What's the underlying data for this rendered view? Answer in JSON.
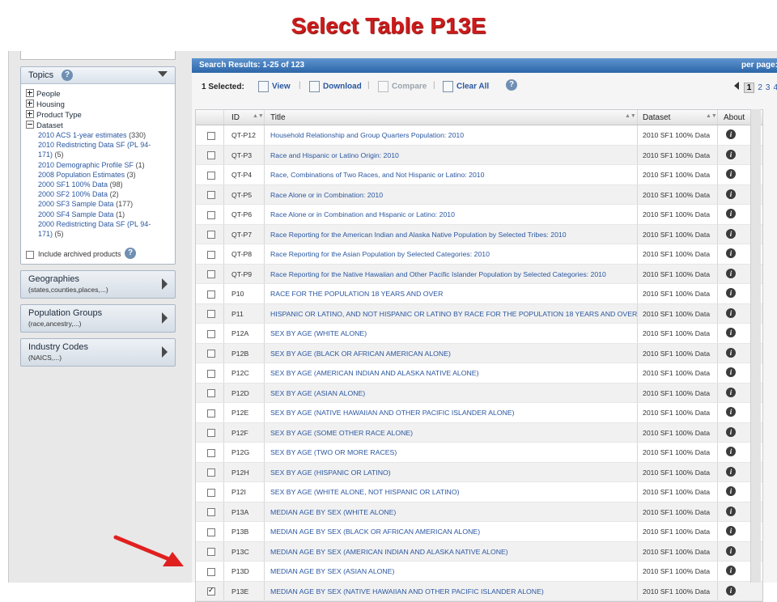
{
  "slide": {
    "title": "Select Table P13E"
  },
  "sidebar": {
    "topics": {
      "label": "Topics",
      "items": [
        {
          "label": "People",
          "state": "collapsed"
        },
        {
          "label": "Housing",
          "state": "collapsed"
        },
        {
          "label": "Product Type",
          "state": "collapsed"
        },
        {
          "label": "Dataset",
          "state": "expanded"
        }
      ],
      "datasets": [
        {
          "name": "2010 ACS 1-year estimates",
          "count": "(330)"
        },
        {
          "name": "2010 Redistricting Data SF (PL 94-",
          "name2": "171)",
          "count": "(5)"
        },
        {
          "name": "2010 Demographic Profile SF",
          "count": "(1)"
        },
        {
          "name": "2008 Population Estimates",
          "count": "(3)"
        },
        {
          "name": "2000 SF1 100% Data",
          "count": "(98)"
        },
        {
          "name": "2000 SF2 100% Data",
          "count": "(2)"
        },
        {
          "name": "2000 SF3 Sample Data",
          "count": "(177)"
        },
        {
          "name": "2000 SF4 Sample Data",
          "count": "(1)"
        },
        {
          "name": "2000 Redistricting Data SF (PL 94-",
          "name2": "171)",
          "count": "(5)"
        }
      ],
      "archived_label": "Include archived products"
    },
    "geographies": {
      "title": "Geographies",
      "subtitle": "(states,counties,places,...)"
    },
    "population_groups": {
      "title": "Population Groups",
      "subtitle": "(race,ancestry,...)"
    },
    "industry_codes": {
      "title": "Industry Codes",
      "subtitle": "(NAICS,...)"
    }
  },
  "results": {
    "header": {
      "prefix": "Search Results:",
      "range": "1-25",
      "of": "of",
      "total": "123",
      "per_page": "per page:"
    },
    "toolbar": {
      "selected_count": "1",
      "selected_label": "Selected:",
      "view": "View",
      "download": "Download",
      "compare": "Compare",
      "clear_all": "Clear All"
    },
    "pager": {
      "pages": [
        "1",
        "2",
        "3",
        "4"
      ],
      "current": "1"
    },
    "columns": {
      "id": "ID",
      "title": "Title",
      "dataset": "Dataset",
      "about": "About"
    },
    "rows": [
      {
        "id": "QT-P12",
        "title": "Household Relationship and Group Quarters Population: 2010",
        "dataset": "2010 SF1 100% Data",
        "checked": false
      },
      {
        "id": "QT-P3",
        "title": "Race and Hispanic or Latino Origin: 2010",
        "dataset": "2010 SF1 100% Data",
        "checked": false
      },
      {
        "id": "QT-P4",
        "title": "Race, Combinations of Two Races, and Not Hispanic or Latino: 2010",
        "dataset": "2010 SF1 100% Data",
        "checked": false
      },
      {
        "id": "QT-P5",
        "title": "Race Alone or in Combination: 2010",
        "dataset": "2010 SF1 100% Data",
        "checked": false
      },
      {
        "id": "QT-P6",
        "title": "Race Alone or in Combination and Hispanic or Latino: 2010",
        "dataset": "2010 SF1 100% Data",
        "checked": false
      },
      {
        "id": "QT-P7",
        "title": "Race Reporting for the American Indian and Alaska Native Population by Selected Tribes: 2010",
        "dataset": "2010 SF1 100% Data",
        "checked": false
      },
      {
        "id": "QT-P8",
        "title": "Race Reporting for the Asian Population by Selected Categories: 2010",
        "dataset": "2010 SF1 100% Data",
        "checked": false
      },
      {
        "id": "QT-P9",
        "title": "Race Reporting for the Native Hawaiian and Other Pacific Islander Population by Selected Categories: 2010",
        "dataset": "2010 SF1 100% Data",
        "checked": false
      },
      {
        "id": "P10",
        "title": "RACE FOR THE POPULATION 18 YEARS AND OVER",
        "dataset": "2010 SF1 100% Data",
        "checked": false
      },
      {
        "id": "P11",
        "title": "HISPANIC OR LATINO, AND NOT HISPANIC OR LATINO BY RACE FOR THE POPULATION 18 YEARS AND OVER",
        "dataset": "2010 SF1 100% Data",
        "checked": false
      },
      {
        "id": "P12A",
        "title": "SEX BY AGE (WHITE ALONE)",
        "dataset": "2010 SF1 100% Data",
        "checked": false
      },
      {
        "id": "P12B",
        "title": "SEX BY AGE (BLACK OR AFRICAN AMERICAN ALONE)",
        "dataset": "2010 SF1 100% Data",
        "checked": false
      },
      {
        "id": "P12C",
        "title": "SEX BY AGE (AMERICAN INDIAN AND ALASKA NATIVE ALONE)",
        "dataset": "2010 SF1 100% Data",
        "checked": false
      },
      {
        "id": "P12D",
        "title": "SEX BY AGE (ASIAN ALONE)",
        "dataset": "2010 SF1 100% Data",
        "checked": false
      },
      {
        "id": "P12E",
        "title": "SEX BY AGE (NATIVE HAWAIIAN AND OTHER PACIFIC ISLANDER ALONE)",
        "dataset": "2010 SF1 100% Data",
        "checked": false
      },
      {
        "id": "P12F",
        "title": "SEX BY AGE (SOME OTHER RACE ALONE)",
        "dataset": "2010 SF1 100% Data",
        "checked": false
      },
      {
        "id": "P12G",
        "title": "SEX BY AGE (TWO OR MORE RACES)",
        "dataset": "2010 SF1 100% Data",
        "checked": false
      },
      {
        "id": "P12H",
        "title": "SEX BY AGE (HISPANIC OR LATINO)",
        "dataset": "2010 SF1 100% Data",
        "checked": false
      },
      {
        "id": "P12I",
        "title": "SEX BY AGE (WHITE ALONE, NOT HISPANIC OR LATINO)",
        "dataset": "2010 SF1 100% Data",
        "checked": false
      },
      {
        "id": "P13A",
        "title": "MEDIAN AGE BY SEX (WHITE ALONE)",
        "dataset": "2010 SF1 100% Data",
        "checked": false
      },
      {
        "id": "P13B",
        "title": "MEDIAN AGE BY SEX (BLACK OR AFRICAN AMERICAN ALONE)",
        "dataset": "2010 SF1 100% Data",
        "checked": false
      },
      {
        "id": "P13C",
        "title": "MEDIAN AGE BY SEX (AMERICAN INDIAN AND ALASKA NATIVE ALONE)",
        "dataset": "2010 SF1 100% Data",
        "checked": false
      },
      {
        "id": "P13D",
        "title": "MEDIAN AGE BY SEX (ASIAN ALONE)",
        "dataset": "2010 SF1 100% Data",
        "checked": false
      },
      {
        "id": "P13E",
        "title": "MEDIAN AGE BY SEX (NATIVE HAWAIIAN AND OTHER PACIFIC ISLANDER ALONE)",
        "dataset": "2010 SF1 100% Data",
        "checked": true
      }
    ]
  },
  "colors": {
    "title_red": "#cc1b1b",
    "link_blue": "#2a57a0",
    "header_blue": "#2c66a8",
    "arrow_red": "#e0201f"
  },
  "annotation": {
    "icon": "red-arrow-icon"
  }
}
